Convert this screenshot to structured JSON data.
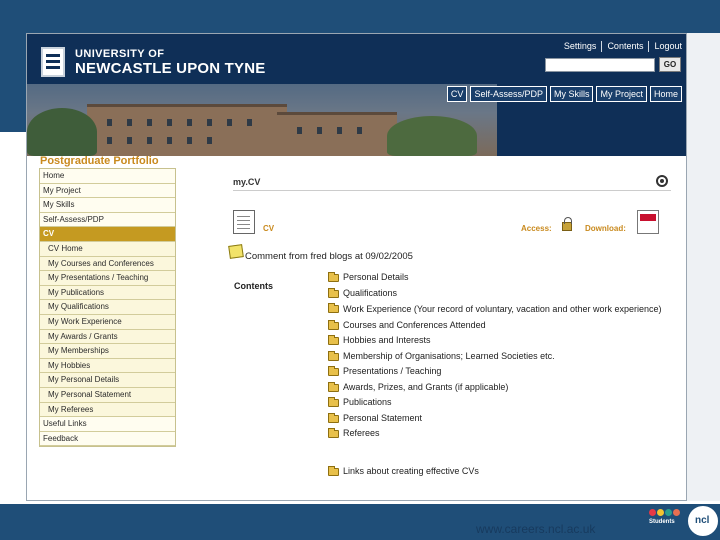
{
  "header": {
    "university_line1": "UNIVERSITY OF",
    "university_line2": "NEWCASTLE UPON TYNE",
    "util_links": [
      "Settings",
      "Contents",
      "Logout"
    ],
    "search": {
      "value": "",
      "placeholder": ""
    },
    "go_label": "GO"
  },
  "nav_tabs": [
    "CV",
    "Self-Assess/PDP",
    "My Skills",
    "My Project",
    "Home"
  ],
  "portfolio_title": "Postgraduate Portfolio",
  "sidebar": {
    "items": [
      {
        "label": "Home",
        "sub": false,
        "active": false
      },
      {
        "label": "My Project",
        "sub": false,
        "active": false
      },
      {
        "label": "My Skills",
        "sub": false,
        "active": false
      },
      {
        "label": "Self-Assess/PDP",
        "sub": false,
        "active": false
      },
      {
        "label": "CV",
        "sub": false,
        "active": true
      },
      {
        "label": "CV Home",
        "sub": true,
        "active": false
      },
      {
        "label": "My Courses and Conferences",
        "sub": true,
        "active": false
      },
      {
        "label": "My Presentations / Teaching",
        "sub": true,
        "active": false
      },
      {
        "label": "My Publications",
        "sub": true,
        "active": false
      },
      {
        "label": "My Qualifications",
        "sub": true,
        "active": false
      },
      {
        "label": "My Work Experience",
        "sub": true,
        "active": false
      },
      {
        "label": "My Awards / Grants",
        "sub": true,
        "active": false
      },
      {
        "label": "My Memberships",
        "sub": true,
        "active": false
      },
      {
        "label": "My Hobbies",
        "sub": true,
        "active": false
      },
      {
        "label": "My Personal Details",
        "sub": true,
        "active": false
      },
      {
        "label": "My Personal Statement",
        "sub": true,
        "active": false
      },
      {
        "label": "My Referees",
        "sub": true,
        "active": false
      },
      {
        "label": "Useful Links",
        "sub": false,
        "active": false
      },
      {
        "label": "Feedback",
        "sub": false,
        "active": false
      }
    ]
  },
  "main": {
    "title": "my.CV",
    "cv_label": "CV",
    "access_label": "Access:",
    "download_label": "Download:",
    "comment": "Comment from fred blogs at 09/02/2005",
    "contents_label": "Contents",
    "contents": [
      "Personal Details",
      "Qualifications",
      "Work Experience (Your record of voluntary, vacation and other work experience)",
      "Courses and Conferences Attended",
      "Hobbies and Interests",
      "Membership of Organisations; Learned Societies etc.",
      "Presentations / Teaching",
      "Awards, Prizes, and Grants (if applicable)",
      "Publications",
      "Personal Statement",
      "Referees",
      "",
      "Links about creating effective CVs"
    ]
  },
  "footer": {
    "url": "www.careers.ncl.ac.uk",
    "students_logo_text": "Students",
    "ncl_logo_text": "ncl"
  },
  "colors": {
    "brand_navy": "#0f2f57",
    "band_blue": "#1f4e78",
    "accent_gold": "#c59a21",
    "accent_orange_text": "#c98a1e"
  }
}
